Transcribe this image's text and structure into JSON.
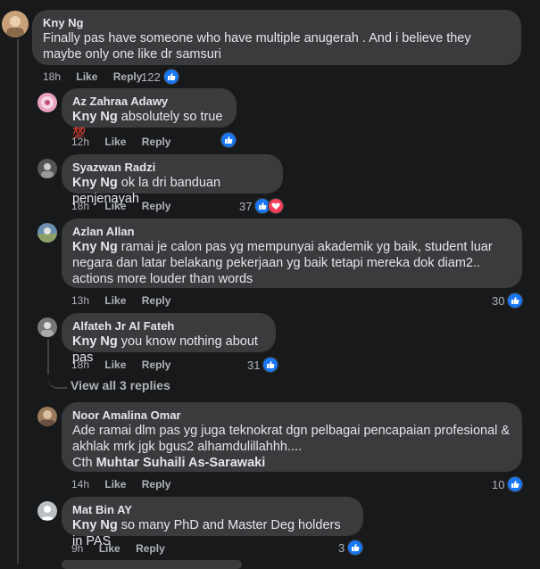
{
  "comments": [
    {
      "author": "Kny Ng",
      "text": "Finally pas have someone who have multiple anugerah . And i believe they maybe only one like dr samsuri",
      "time": "18h",
      "like": "Like",
      "reply": "Reply",
      "reactions": "122"
    },
    {
      "author": "Az Zahraa Adawy",
      "mention": "Kny Ng",
      "text": " absolutely so true ",
      "emoji": "💯",
      "time": "12h",
      "like": "Like",
      "reply": "Reply",
      "reactions": ""
    },
    {
      "author": "Syazwan Radzi",
      "mention": "Kny Ng",
      "text": " ok la dri banduan penjenayah",
      "time": "18h",
      "like": "Like",
      "reply": "Reply",
      "reactions": "37"
    },
    {
      "author": "Azlan Allan",
      "mention": "Kny Ng",
      "text": " ramai je calon pas yg mempunyai akademik yg baik, student luar negara dan latar belakang pekerjaan yg baik tetapi mereka dok diam2.. actions more louder than words",
      "time": "13h",
      "like": "Like",
      "reply": "Reply",
      "reactions": "30"
    },
    {
      "author": "Alfateh Jr Al Fateh",
      "mention": "Kny Ng",
      "text": " you know nothing about pas",
      "time": "18h",
      "like": "Like",
      "reply": "Reply",
      "reactions": "31"
    },
    {
      "author": "Noor Amalina Omar",
      "text": "Ade ramai dlm pas yg juga teknokrat dgn pelbagai pencapaian profesional & akhlak mrk jgk bgus2 alhamdulillahhh....",
      "line2_prefix": "Cth ",
      "mention": "Muhtar Suhaili As-Sarawaki",
      "time": "14h",
      "like": "Like",
      "reply": "Reply",
      "reactions": "10"
    },
    {
      "author": "Mat Bin AY",
      "mention": "Kny Ng",
      "text": " so many PhD and Master Deg holders in PAS",
      "time": "9h",
      "like": "Like",
      "reply": "Reply",
      "reactions": "3"
    }
  ],
  "view_replies": "View all 3 replies",
  "colors": {
    "like": "#1877f2",
    "love": "#f33e58",
    "bubble": "#3a3b3c",
    "background": "#18191a"
  }
}
